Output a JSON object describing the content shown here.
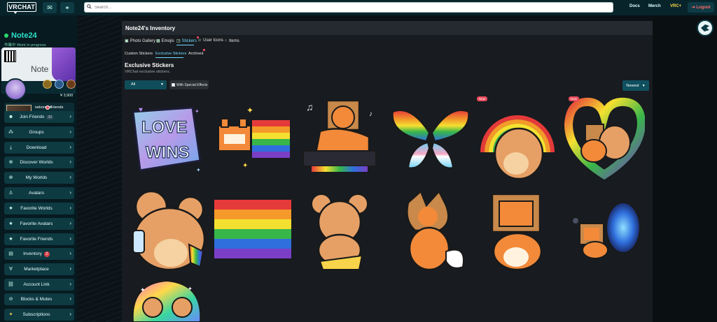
{
  "topbar": {
    "logo": "VRCHAT",
    "search_placeholder": "Search...",
    "links": [
      "Docs",
      "Merch",
      "VRC+"
    ],
    "logout": "Logout"
  },
  "user": {
    "name": "Note24",
    "status": "作業中 Work in progress",
    "card_text": "Note",
    "currency": "¥ 3,900",
    "instance_name": "nekoroom",
    "instance_scope": "Friends"
  },
  "sidebar": {
    "items": [
      {
        "label": "Join Friends",
        "count": "39",
        "icon": "people"
      },
      {
        "label": "Groups",
        "icon": "groups"
      },
      {
        "label": "Download",
        "icon": "download"
      },
      {
        "label": "Discover Worlds",
        "icon": "globe"
      },
      {
        "label": "My Worlds",
        "icon": "globe"
      },
      {
        "label": "Avatars",
        "icon": "person"
      },
      {
        "label": "Favorite Worlds",
        "icon": "star"
      },
      {
        "label": "Favorite Avatars",
        "icon": "star"
      },
      {
        "label": "Favorite Friends",
        "icon": "star"
      },
      {
        "label": "Inventory",
        "alert": "2",
        "icon": "box"
      },
      {
        "label": "Marketplace",
        "icon": "market"
      },
      {
        "label": "Account Link",
        "icon": "link"
      },
      {
        "label": "Blocks & Mutes",
        "icon": "block"
      },
      {
        "label": "Subscriptions",
        "icon": "vrc-plus"
      }
    ]
  },
  "inventory": {
    "title": "Note24's Inventory",
    "tabs": [
      "Photo Gallery",
      "Emojis",
      "Stickers",
      "User Icons",
      "Items"
    ],
    "active_tab": "Stickers",
    "subtabs": [
      "Custom Stickers",
      "Exclusive Stickers",
      "Archived"
    ],
    "active_subtab": "Exclusive Stickers",
    "section_title": "Exclusive Stickers",
    "section_subtitle": "VRChat exclusive stickers.",
    "filter_label": "All",
    "effects_label": "With Special Effects",
    "sort_label": "Newest",
    "badges": [
      "New",
      "New"
    ],
    "love_text_top": "LOVE",
    "love_text_bottom": "WINS"
  },
  "colors": {
    "accent": "#2be0c8",
    "topbar": "#07242b",
    "panel": "#181b1f",
    "menu": "#0e3a42",
    "alert": "#e94b5c"
  }
}
